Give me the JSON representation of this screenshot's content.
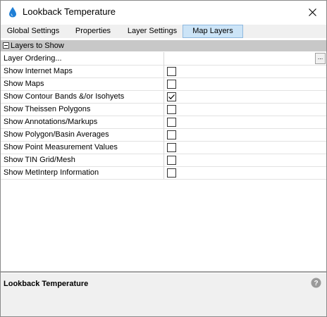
{
  "window": {
    "title": "Lookback Temperature",
    "icon": "water-drop-icon",
    "close_icon": "close-icon"
  },
  "tabs": [
    {
      "label": "Global Settings",
      "active": false
    },
    {
      "label": "Properties",
      "active": false
    },
    {
      "label": "Layer Settings",
      "active": false
    },
    {
      "label": "Map Layers",
      "active": true
    }
  ],
  "grid": {
    "category": "Layers to Show",
    "layer_ordering": {
      "label": "Layer Ordering...",
      "button": "..."
    },
    "rows": [
      {
        "label": "Show Internet Maps",
        "checked": false
      },
      {
        "label": "Show Maps",
        "checked": false
      },
      {
        "label": "Show Contour Bands &/or Isohyets",
        "checked": true
      },
      {
        "label": "Show Theissen Polygons",
        "checked": false
      },
      {
        "label": "Show Annotations/Markups",
        "checked": false
      },
      {
        "label": "Show Polygon/Basin Averages",
        "checked": false
      },
      {
        "label": "Show Point Measurement Values",
        "checked": false
      },
      {
        "label": "Show TIN Grid/Mesh",
        "checked": false
      },
      {
        "label": "Show MetInterp Information",
        "checked": false
      }
    ]
  },
  "description": {
    "title": "Lookback Temperature",
    "help_icon": "help-icon"
  },
  "colors": {
    "active_tab": "#cce4f7",
    "category_header": "#c8c8c8",
    "app_icon": "#1f7fd6"
  }
}
